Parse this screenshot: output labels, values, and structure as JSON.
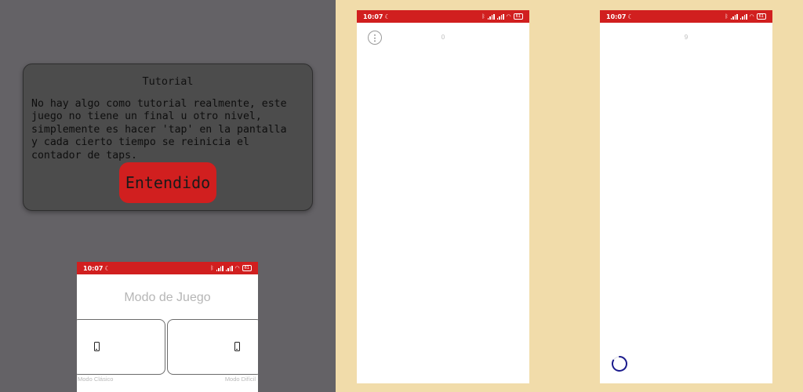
{
  "tutorial": {
    "title": "Tutorial",
    "body": "No hay algo como tutorial realmente, este\njuego no tiene un final u otro nivel,\nsimplemente es hacer 'tap' en la pantalla\ny cada cierto tiempo se reinicia el\ncontador de taps.",
    "button_label": "Entendido"
  },
  "status_bar": {
    "time": "10:07",
    "battery": "61"
  },
  "mode_screen": {
    "title": "Modo de Juego",
    "classic_label": "Modo Clásico",
    "hard_label": "Modo Difícil"
  },
  "game_screen_1": {
    "counter": "0"
  },
  "game_screen_2": {
    "counter": "9"
  },
  "colors": {
    "accent_red": "#d11f1f",
    "dim_overlay": "#646266",
    "background": "#f1dcaa",
    "spinner": "#1a1a8c"
  },
  "icons": [
    "phone-icon",
    "more-vert-icon",
    "moon-icon",
    "bluetooth-icon",
    "signal-icon",
    "wifi-icon",
    "battery-icon",
    "loading-spinner"
  ]
}
